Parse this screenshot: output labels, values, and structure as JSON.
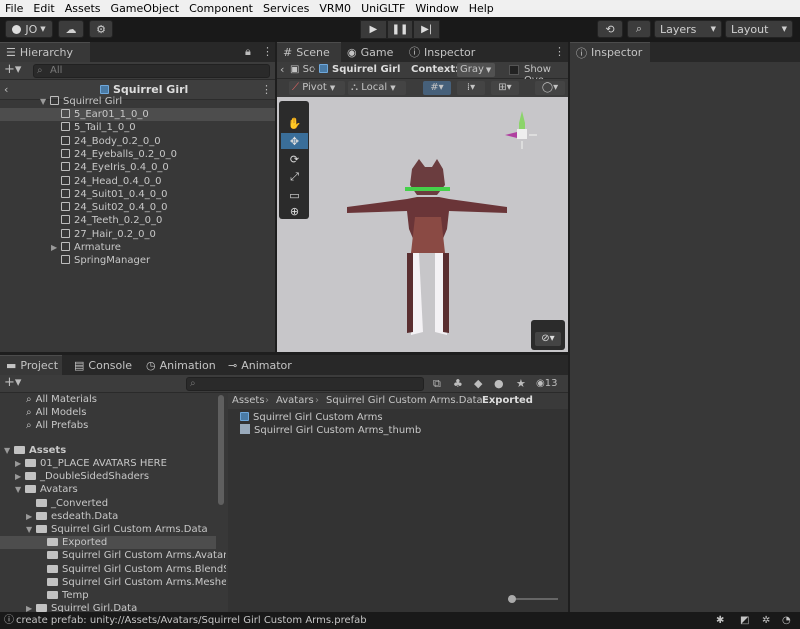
{
  "menu": [
    "File",
    "Edit",
    "Assets",
    "GameObject",
    "Component",
    "Services",
    "VRM0",
    "UniGLTF",
    "Window",
    "Help"
  ],
  "toolbar": {
    "account": "JO",
    "layers": "Layers",
    "layout": "Layout"
  },
  "hierarchy": {
    "tab": "Hierarchy",
    "search_placeholder": "All",
    "scene_title": "Squirrel Girl",
    "root": "Squirrel Girl",
    "items": [
      "5_Ear01_1_0_0",
      "5_Tail_1_0_0",
      "24_Body_0.2_0_0",
      "24_Eyeballs_0.2_0_0",
      "24_EyeIris_0.4_0_0",
      "24_Head_0.4_0_0",
      "24_Suit01_0.4_0_0",
      "24_Suit02_0.4_0_0",
      "24_Teeth_0.2_0_0",
      "27_Hair_0.2_0_0",
      "Armature",
      "SpringManager"
    ]
  },
  "scene": {
    "tabs": [
      "Scene",
      "Game",
      "Inspector"
    ],
    "breadcrumb_short": "Sc",
    "breadcrumb_obj": "Squirrel Girl",
    "context_label": "Context:",
    "context_value": "Gray",
    "show_overrides": "Show Ove",
    "pivot": "Pivot",
    "local": "Local"
  },
  "inspector": {
    "tab": "Inspector"
  },
  "bottom_tabs": [
    "Project",
    "Console",
    "Animation",
    "Animator"
  ],
  "project": {
    "hidden_count": "13",
    "favorites": [
      "All Materials",
      "All Models",
      "All Prefabs"
    ],
    "assets_label": "Assets",
    "tree": [
      {
        "label": "01_PLACE AVATARS HERE",
        "indent": 1,
        "arrow": "▶"
      },
      {
        "label": "_DoubleSidedShaders",
        "indent": 1,
        "arrow": "▶"
      },
      {
        "label": "Avatars",
        "indent": 1,
        "arrow": "▼"
      },
      {
        "label": "_Converted",
        "indent": 2,
        "arrow": ""
      },
      {
        "label": "esdeath.Data",
        "indent": 2,
        "arrow": "▶"
      },
      {
        "label": "Squirrel Girl Custom Arms.Data",
        "indent": 2,
        "arrow": "▼"
      },
      {
        "label": "Exported",
        "indent": 3,
        "arrow": ""
      },
      {
        "label": "Squirrel Girl Custom Arms.Avatar",
        "indent": 3,
        "arrow": ""
      },
      {
        "label": "Squirrel Girl Custom Arms.BlendS",
        "indent": 3,
        "arrow": ""
      },
      {
        "label": "Squirrel Girl Custom Arms.Meshes",
        "indent": 3,
        "arrow": ""
      },
      {
        "label": "Temp",
        "indent": 3,
        "arrow": ""
      },
      {
        "label": "Squirrel Girl.Data",
        "indent": 2,
        "arrow": "▶"
      }
    ],
    "path": [
      "Assets",
      "Avatars",
      "Squirrel Girl Custom Arms.Data",
      "Exported"
    ],
    "files": [
      "Squirrel Girl Custom Arms",
      "Squirrel Girl Custom Arms_thumb"
    ]
  },
  "status": "create prefab: unity://Assets/Avatars/Squirrel Girl Custom Arms.prefab"
}
